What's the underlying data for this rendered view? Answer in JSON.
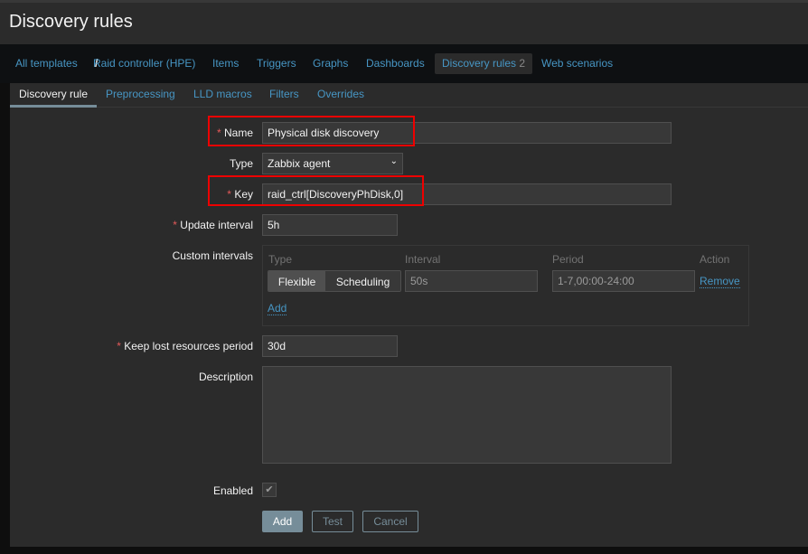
{
  "page_title": "Discovery rules",
  "nav": {
    "all_templates": "All templates",
    "separator": "/",
    "template": "Raid controller (HPE)",
    "items": "Items",
    "triggers": "Triggers",
    "graphs": "Graphs",
    "dashboards": "Dashboards",
    "discovery_rules": "Discovery rules",
    "discovery_count": "2",
    "web_scenarios": "Web scenarios"
  },
  "tabs": [
    "Discovery rule",
    "Preprocessing",
    "LLD macros",
    "Filters",
    "Overrides"
  ],
  "form": {
    "name_label": "Name",
    "name_value": "Physical disk discovery",
    "type_label": "Type",
    "type_value": "Zabbix agent",
    "key_label": "Key",
    "key_value": "raid_ctrl[DiscoveryPhDisk,0]",
    "update_label": "Update interval",
    "update_value": "5h",
    "custom_label": "Custom intervals",
    "custom": {
      "headers": [
        "Type",
        "Interval",
        "Period",
        "Action"
      ],
      "flexible": "Flexible",
      "scheduling": "Scheduling",
      "interval": "50s",
      "period": "1-7,00:00-24:00",
      "remove": "Remove",
      "add": "Add"
    },
    "keep_label": "Keep lost resources period",
    "keep_value": "30d",
    "description_label": "Description",
    "description_value": "",
    "enabled_label": "Enabled",
    "enabled": true,
    "required_mark": "*"
  },
  "buttons": {
    "add": "Add",
    "test": "Test",
    "cancel": "Cancel"
  },
  "colors": {
    "accent": "#4796c4",
    "highlight": "#ee0000",
    "required": "#e45959"
  }
}
